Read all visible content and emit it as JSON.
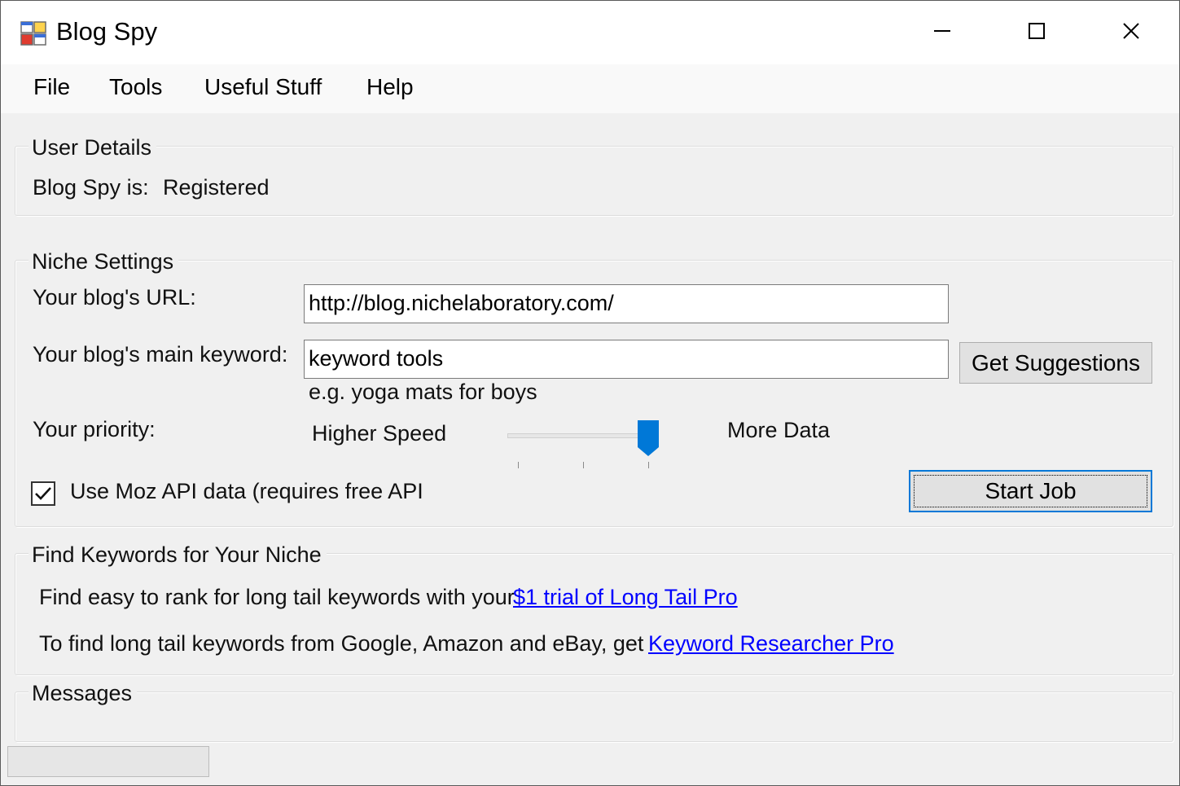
{
  "window": {
    "title": "Blog Spy",
    "icon": "app-windows-icon"
  },
  "menu": [
    "File",
    "Tools",
    "Useful Stuff",
    "Help"
  ],
  "user_details": {
    "legend": "User Details",
    "status_label": "Blog Spy is:",
    "status_value": "Registered"
  },
  "niche_settings": {
    "legend": "Niche Settings",
    "url_label": "Your blog's URL:",
    "url_value": "http://blog.nichelaboratory.com/",
    "keyword_label": "Your blog's main keyword:",
    "keyword_value": "keyword tools",
    "keyword_hint": "e.g. yoga mats for boys",
    "suggestions_button": "Get Suggestions",
    "priority_label": "Your priority:",
    "priority_low_label": "Higher Speed",
    "priority_high_label": "More Data",
    "priority_level": 1.0,
    "moz_checkbox_label": "Use Moz API data (requires free API",
    "moz_checked": true,
    "start_button": "Start Job"
  },
  "find_keywords": {
    "legend": "Find Keywords for Your Niche",
    "line1_text": "Find easy to rank for long tail keywords with your",
    "line1_link": "$1 trial of Long Tail Pro",
    "line2_text": "To find long tail keywords from Google, Amazon and eBay, get",
    "line2_link": "Keyword Researcher Pro"
  },
  "messages": {
    "legend": "Messages"
  },
  "colors": {
    "accent": "#0078d7",
    "link": "#0000ff",
    "window_bg": "#f0f0f0"
  }
}
